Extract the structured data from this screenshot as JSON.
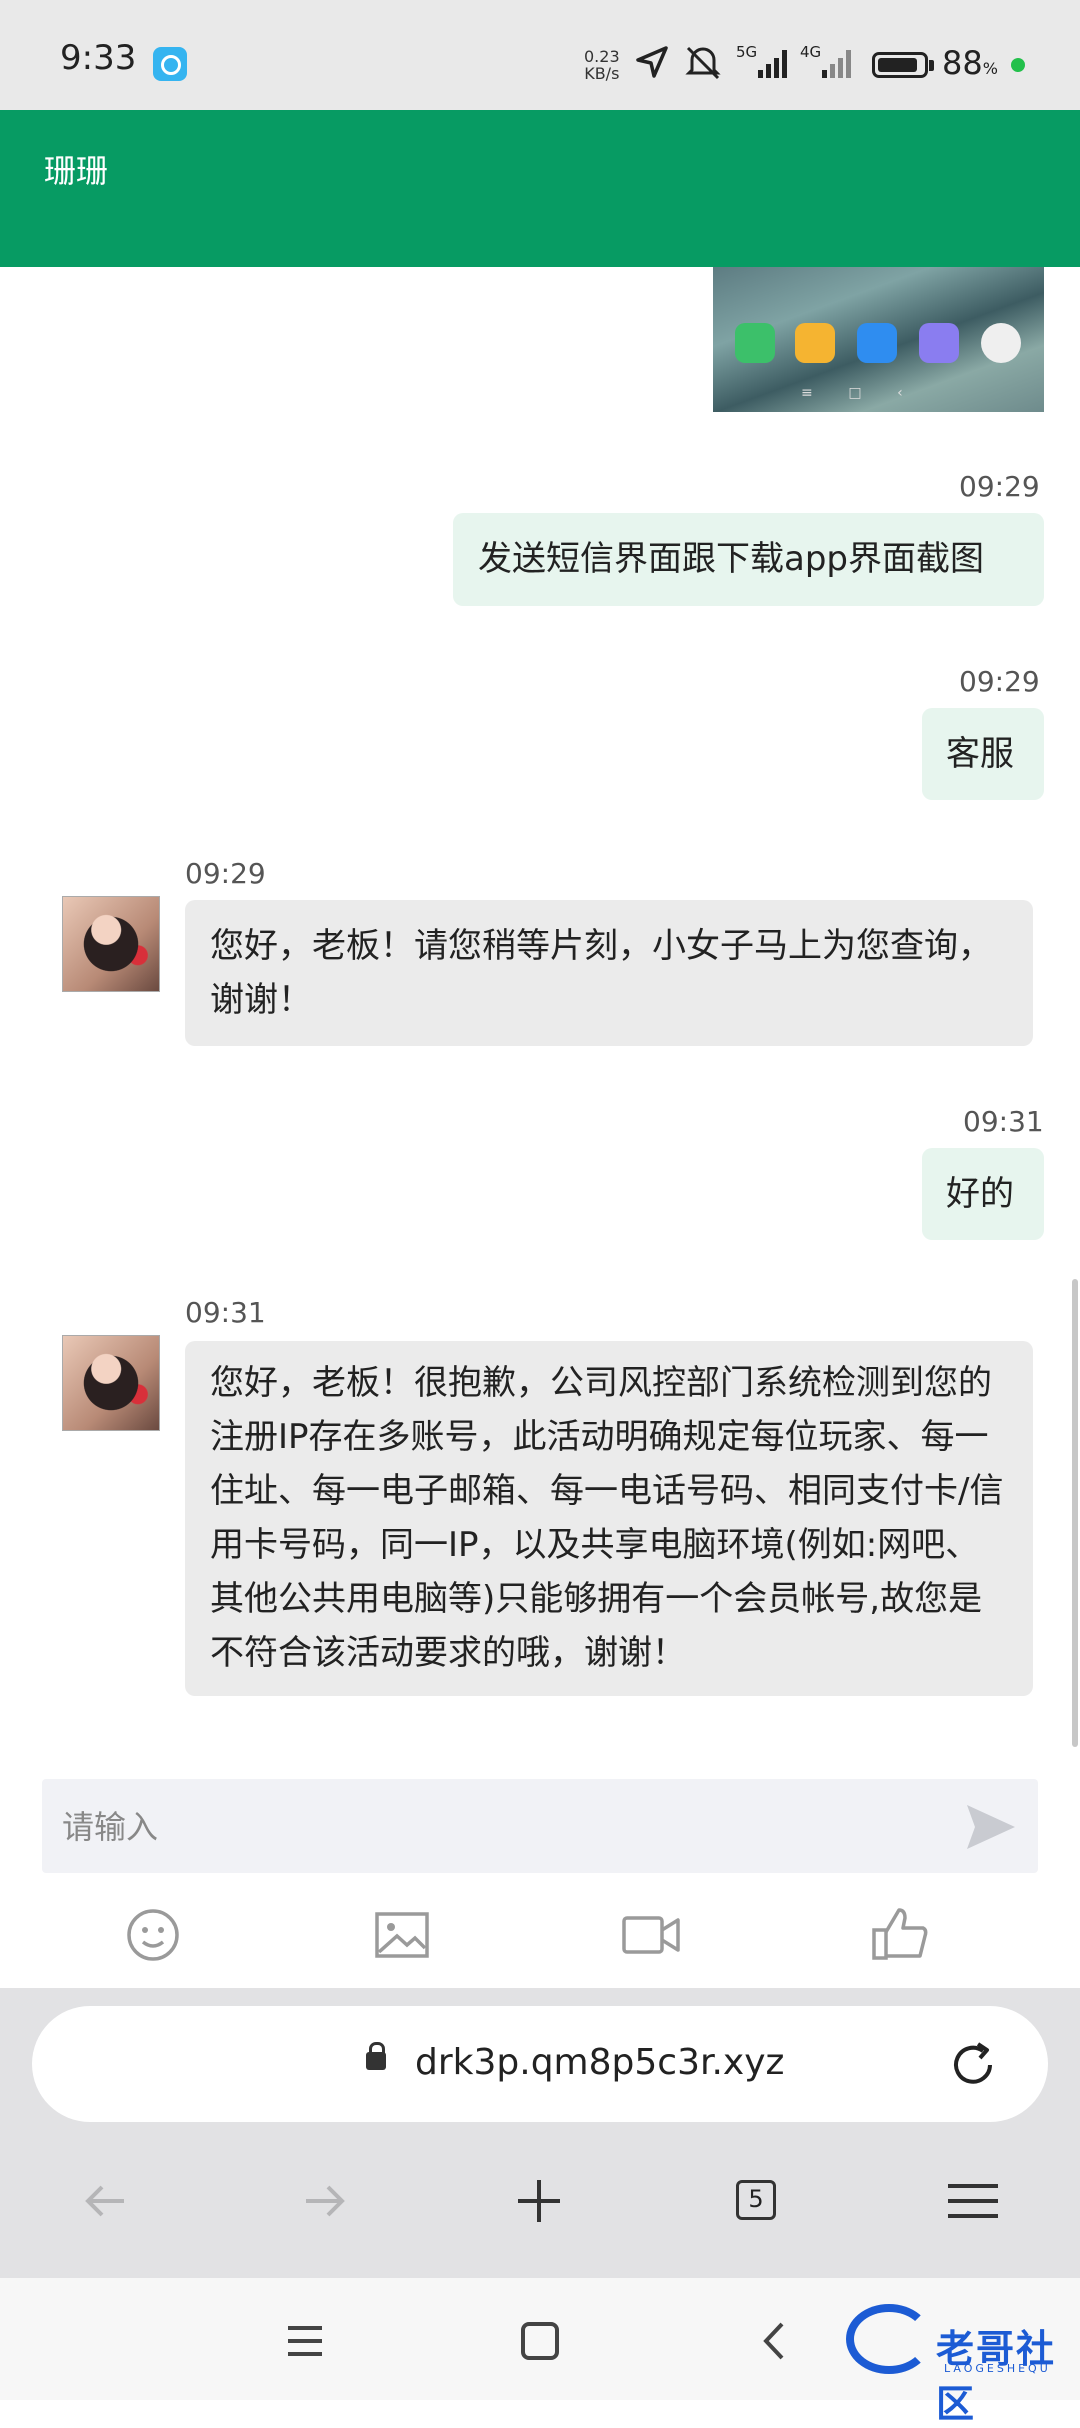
{
  "status_bar": {
    "time": "9:33",
    "net_speed_value": "0.23",
    "net_speed_unit": "KB/s",
    "signal_5g": "5G",
    "signal_4g": "4G",
    "battery_percent": "88",
    "battery_unit": "%",
    "battery_level": 0.88
  },
  "header": {
    "title": "珊珊"
  },
  "chat": {
    "messages": [
      {
        "direction": "out",
        "type": "image"
      },
      {
        "direction": "out",
        "time": "09:29",
        "text": "发送短信界面跟下载app界面截图"
      },
      {
        "direction": "out",
        "time": "09:29",
        "text": "客服"
      },
      {
        "direction": "in",
        "time": "09:29",
        "text": "您好，老板！请您稍等片刻，小女子马上为您查询，谢谢！"
      },
      {
        "direction": "out",
        "time": "09:31",
        "text": "好的"
      },
      {
        "direction": "in",
        "time": "09:31",
        "text": "您好，老板！很抱歉，公司风控部门系统检测到您的注册IP存在多账号，此活动明确规定每位玩家、每一住址、每一电子邮箱、每一电话号码、相同支付卡/信用卡号码，同一IP，以及共享电脑环境(例如:网吧、其他公共用电脑等)只能够拥有一个会员帐号,故您是不符合该活动要求的哦，谢谢！"
      }
    ]
  },
  "input": {
    "placeholder": "请输入"
  },
  "toolbar": {
    "icons": [
      "emoji-icon",
      "image-icon",
      "video-icon",
      "thumbs-up-icon"
    ]
  },
  "browser": {
    "url": "drk3p.qm8p5c3r.xyz",
    "tab_count": "5"
  },
  "watermark": {
    "text": "老哥社区",
    "sub": "LAOGESHEQU"
  },
  "colors": {
    "header": "#079b63",
    "outgoing_bubble": "#e7f5ee",
    "incoming_bubble": "#ebebeb",
    "accent_dot": "#23c04b"
  }
}
